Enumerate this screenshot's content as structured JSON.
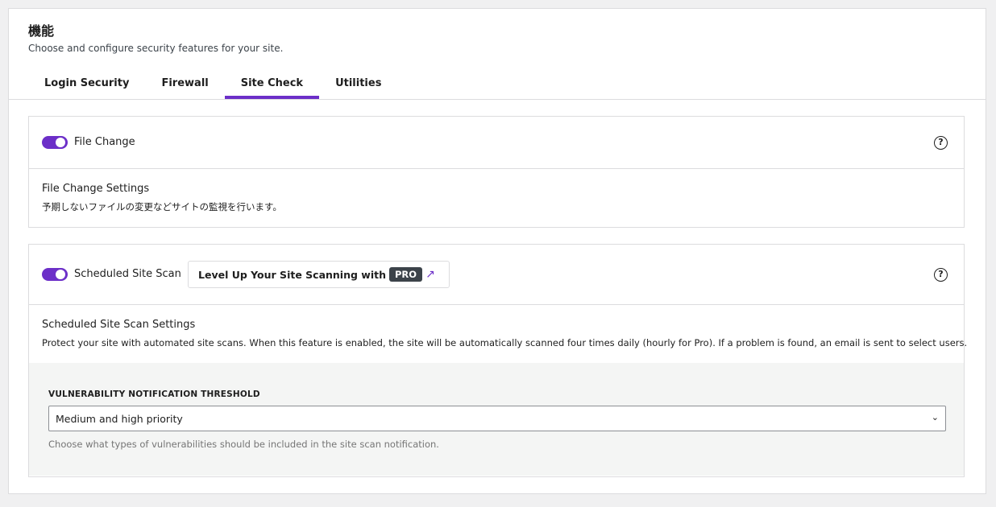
{
  "header": {
    "title": "機能",
    "subtitle": "Choose and configure security features for your site."
  },
  "tabs": [
    {
      "label": "Login Security",
      "active": false
    },
    {
      "label": "Firewall",
      "active": false
    },
    {
      "label": "Site Check",
      "active": true
    },
    {
      "label": "Utilities",
      "active": false
    }
  ],
  "file_change": {
    "label": "File Change",
    "enabled": true,
    "settings_title": "File Change Settings",
    "settings_desc": "予期しないファイルの変更などサイトの監視を行います。",
    "help_icon": "question-circle-icon"
  },
  "scheduled_scan": {
    "label": "Scheduled Site Scan",
    "enabled": true,
    "promo_text": "Level Up Your Site Scanning with",
    "promo_badge": "PRO",
    "promo_icon": "external-arrow-icon",
    "settings_title": "Scheduled Site Scan Settings",
    "settings_desc": "Protect your site with automated site scans. When this feature is enabled, the site will be automatically scanned four times daily (hourly for Pro). If a problem is found, an email is sent to select users.",
    "help_icon": "question-circle-icon",
    "threshold": {
      "label": "VULNERABILITY NOTIFICATION THRESHOLD",
      "value": "Medium and high priority",
      "help": "Choose what types of vulnerabilities should be included in the site scan notification."
    }
  },
  "colors": {
    "accent": "#6c2fc8",
    "border": "#dcdcde",
    "page_bg": "#f0f0f1"
  }
}
